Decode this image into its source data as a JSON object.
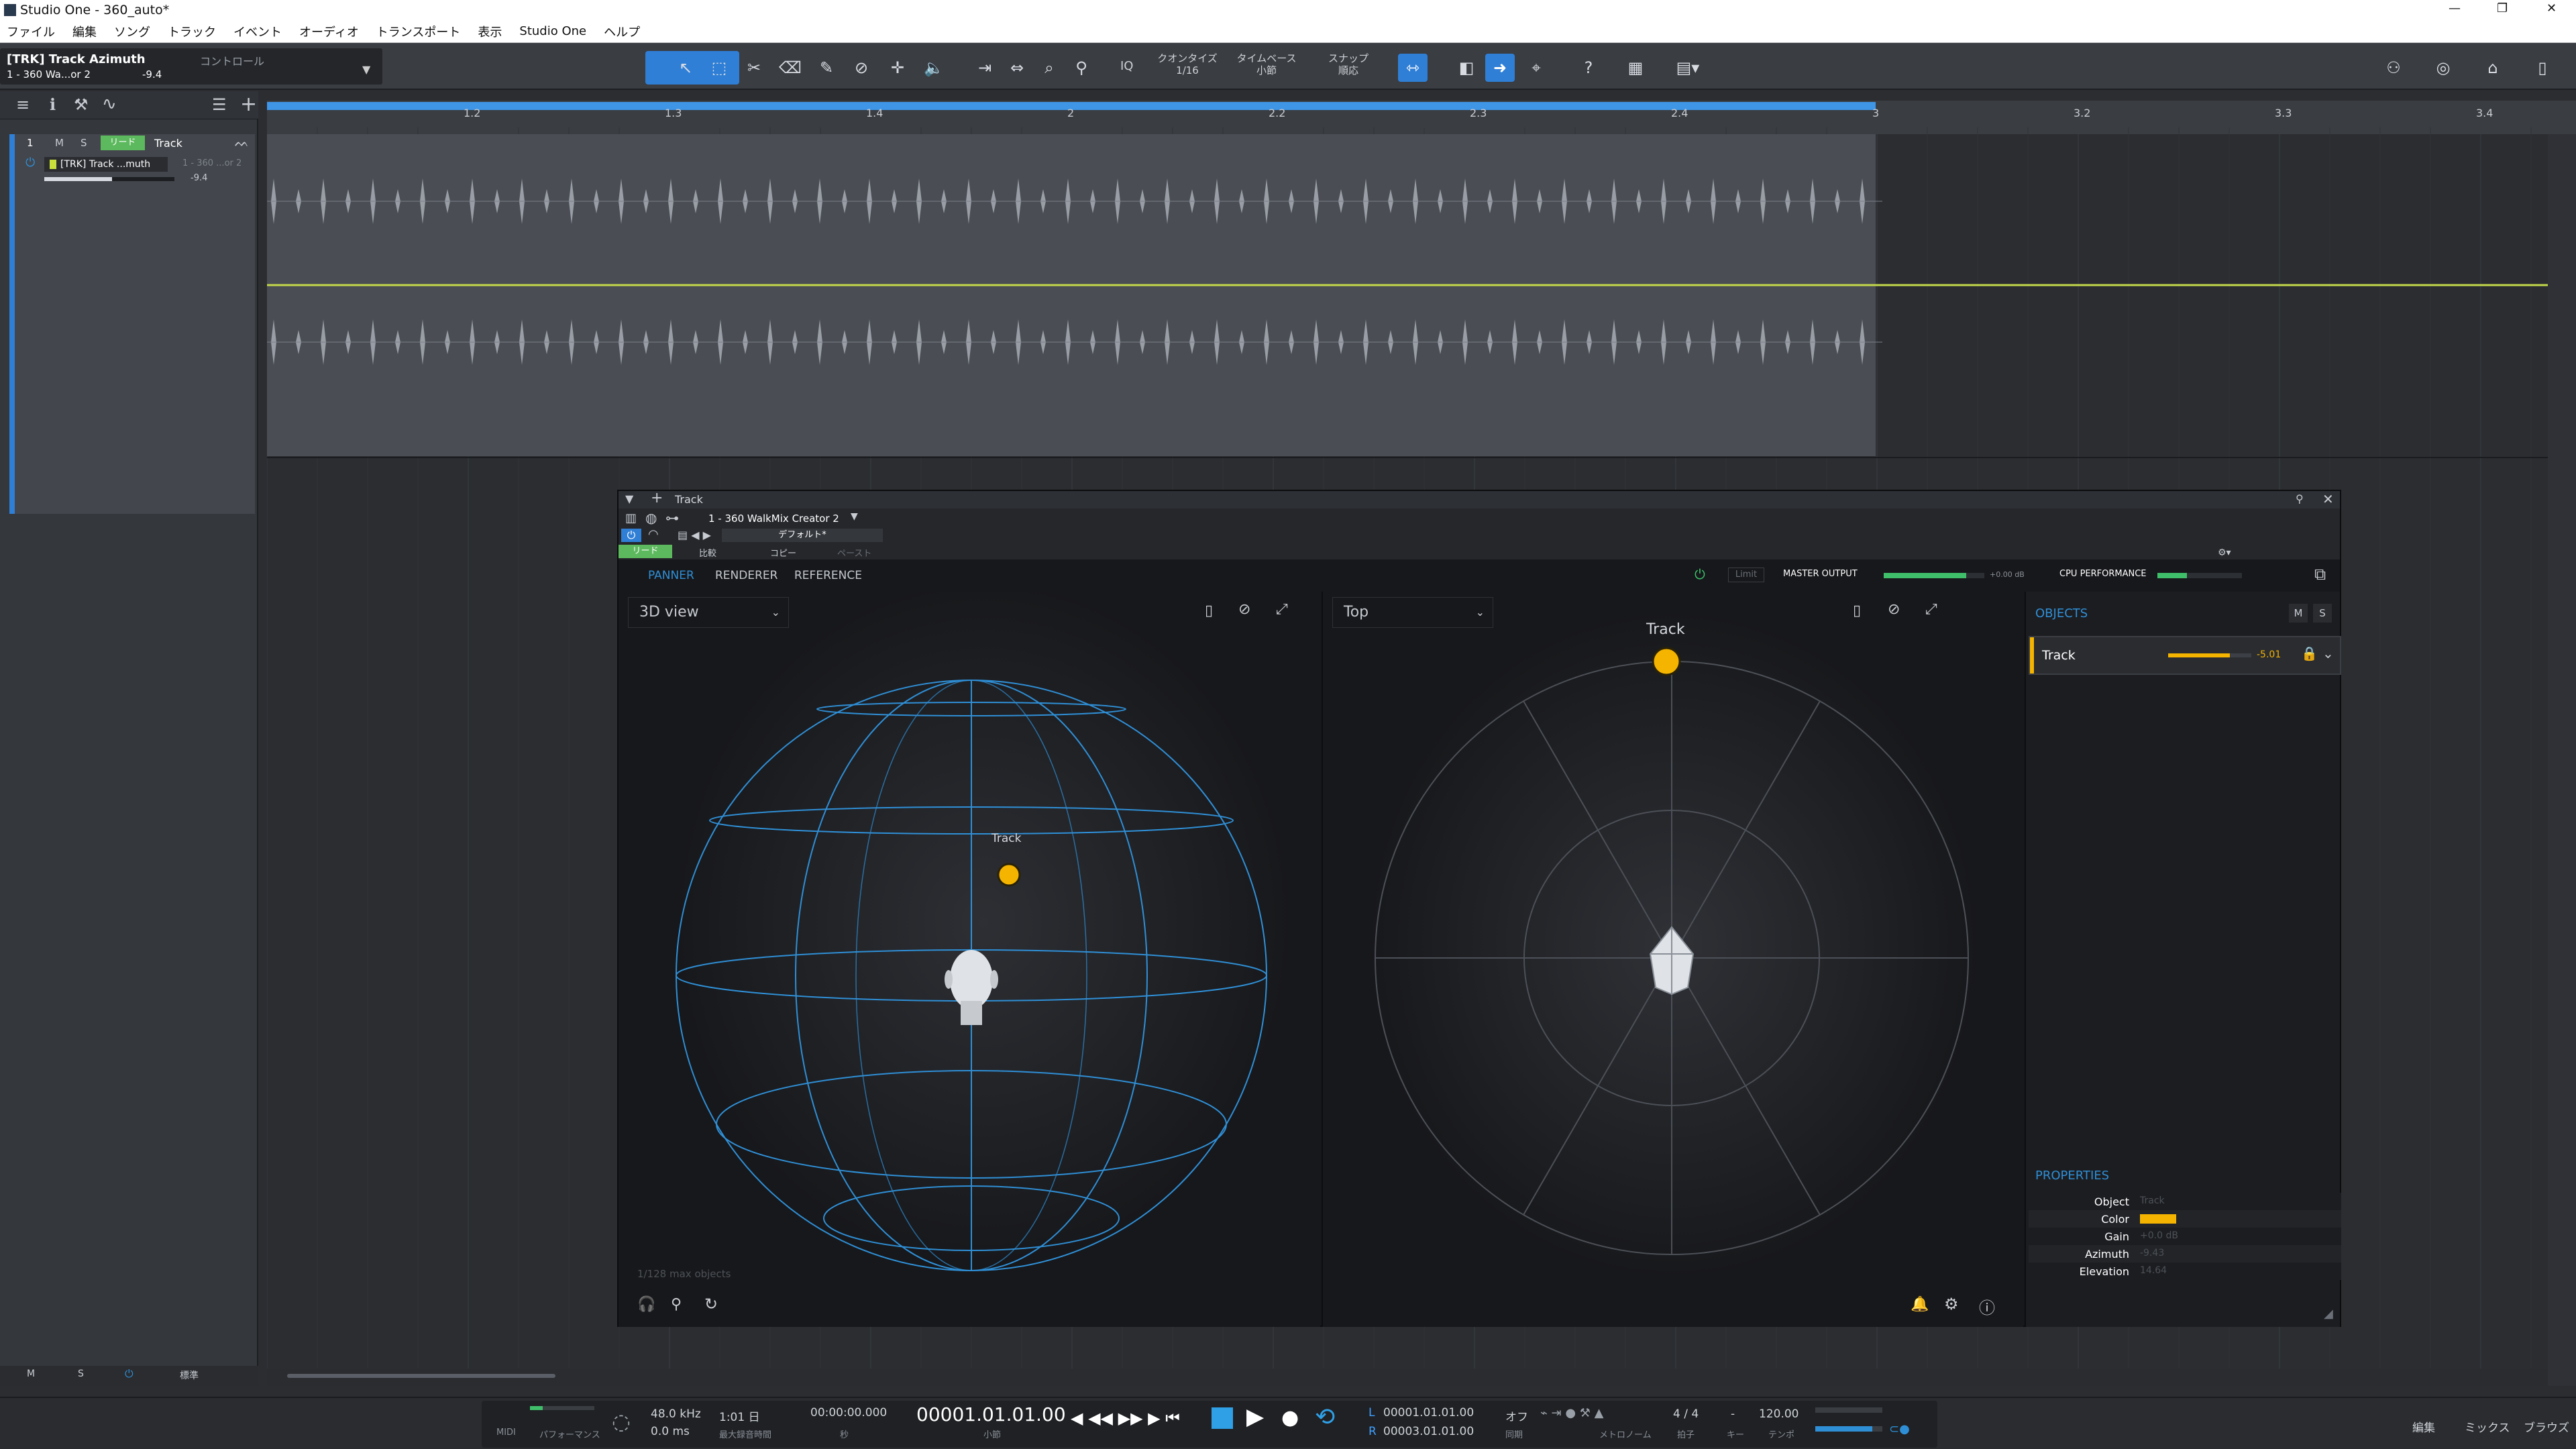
{
  "window": {
    "title": "Studio One - 360_auto*",
    "min": "—",
    "max": "❐",
    "close": "✕"
  },
  "menu": [
    "ファイル",
    "編集",
    "ソング",
    "トラック",
    "イベント",
    "オーディオ",
    "トランスポート",
    "表示",
    "Studio One",
    "ヘルプ"
  ],
  "toolbar": {
    "track_name": "[TRK] Track Azimuth",
    "track_sub": "1 - 360 Wa...or 2",
    "track_value": "-9.4",
    "control_label": "コントロール",
    "iq": "IQ",
    "quantize_label": "クオンタイズ",
    "quantize_value": "1/16",
    "timebase_label": "タイムベース",
    "timebase_value": "小節",
    "snap_label": "スナップ",
    "snap_value": "順応",
    "help": "?"
  },
  "track": {
    "number": "1",
    "m": "M",
    "s": "S",
    "read": "リード",
    "name": "Track",
    "automation": "[TRK] Track ...muth",
    "automation_sub": "1 - 360 ...or 2",
    "value": "-9.4"
  },
  "leftbottom": {
    "m": "M",
    "s": "S",
    "std": "標準"
  },
  "ruler": [
    "1.2",
    "1.3",
    "1.4",
    "2",
    "2.2",
    "2.3",
    "2.4",
    "3",
    "3.2",
    "3.3",
    "3.4"
  ],
  "plugin": {
    "title": "Track",
    "insert": "1 - 360 WalkMix Creator 2",
    "preset": "デフォルト*",
    "read": "リード",
    "compare": "比較",
    "copy": "コピー",
    "paste": "ペースト",
    "tabs": [
      "PANNER",
      "RENDERER",
      "REFERENCE"
    ],
    "limit": "Limit",
    "master_output": "MASTER OUTPUT",
    "master_db": "+0.00 dB",
    "master_level": 0.82,
    "cpu": "CPU PERFORMANCE",
    "cpu_level": 0.35,
    "view3d": "3D view",
    "viewtop": "Top",
    "object_label": "Track",
    "max_objects": "1/128 max objects",
    "objects_title": "OBJECTS",
    "obj_m": "M",
    "obj_s": "S",
    "obj_name": "Track",
    "obj_gain": "-5.01",
    "obj_gain_level": 0.74,
    "properties_title": "PROPERTIES",
    "props": [
      {
        "k": "Object",
        "v": "Track"
      },
      {
        "k": "Color",
        "v": ""
      },
      {
        "k": "Gain",
        "v": "+0.0 dB"
      },
      {
        "k": "Azimuth",
        "v": "-9.43"
      },
      {
        "k": "Elevation",
        "v": "14.64"
      }
    ],
    "object_color": "#f5b400",
    "accent": "#2f8fd6"
  },
  "transport": {
    "midi": "MIDI",
    "perf": "パフォーマンス",
    "rate": "48.0 kHz",
    "latency": "0.0 ms",
    "rec_len": "1:01 日",
    "rec_sub": "最大録音時間",
    "seconds": "00:00:00.000",
    "seconds_sub": "秒",
    "bars": "00001.01.01.00",
    "bars_sub": "小節",
    "loop_l": "00001.01.01.00",
    "loop_r": "00003.01.01.00",
    "sync": "オフ",
    "sync_sub": "同期",
    "metronome": "メトロノーム",
    "sig": "4 / 4",
    "sig_sub": "拍子",
    "key": "-",
    "key_sub": "キー",
    "tempo": "120.00",
    "tempo_sub": "テンポ",
    "edit": "編集",
    "mix": "ミックス",
    "browse": "ブラウズ"
  }
}
